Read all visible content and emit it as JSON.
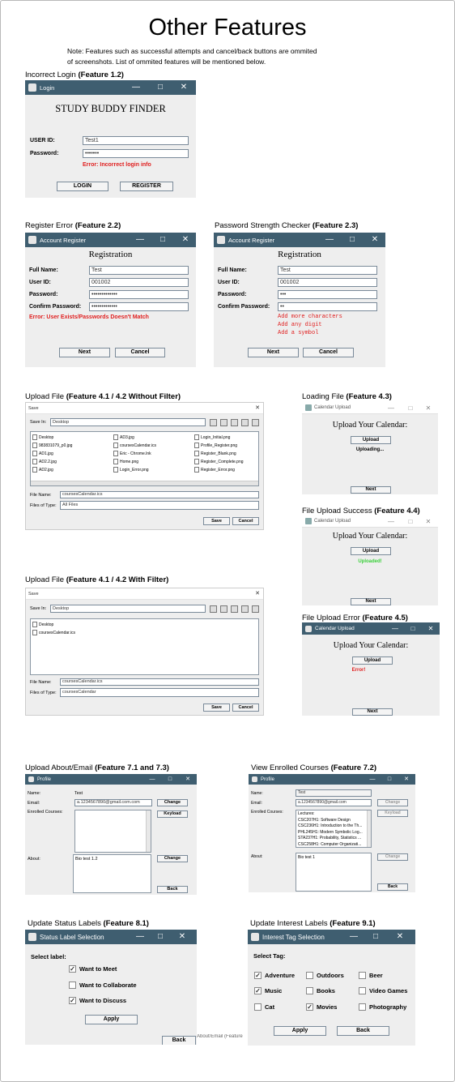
{
  "page": {
    "title": "Other Features",
    "note_line1": "Note: Features such as successful attempts and cancel/back buttons are ommited",
    "note_line2": "of screenshots. List of ommited features will be mentioned below."
  },
  "sections": {
    "s1": {
      "text": "Incorrect Login ",
      "bold": "(Feature 1.2)"
    },
    "s2": {
      "text": "Register Error ",
      "bold": "(Feature 2.2)"
    },
    "s3": {
      "text": "Password Strength Checker ",
      "bold": "(Feature 2.3)"
    },
    "s4": {
      "text": "Upload File ",
      "bold": "(Feature 4.1 / 4.2 Without Filter)"
    },
    "s5": {
      "text": "Loading File ",
      "bold": "(Feature 4.3)"
    },
    "s6": {
      "text": "File Upload Success ",
      "bold": "(Feature 4.4)"
    },
    "s7": {
      "text": "Upload File ",
      "bold": "(Feature 4.1 / 4.2 With Filter)"
    },
    "s8": {
      "text": "File Upload Error ",
      "bold": "(Feature 4.5)"
    },
    "s9": {
      "text": "Upload About/Email ",
      "bold": "(Feature 7.1 and 7.3)"
    },
    "s10": {
      "text": "View  Enrolled Courses ",
      "bold": "(Feature 7.2)"
    },
    "s11": {
      "text": "Update Status Labels ",
      "bold": "(Feature 8.1)"
    },
    "s12": {
      "text": "Update Interest Labels ",
      "bold": "(Feature 9.1)"
    }
  },
  "login": {
    "title": "Login",
    "header": "STUDY BUDDY FINDER",
    "userid_label": "USER ID:",
    "userid_value": "Test1",
    "password_label": "Password:",
    "password_value": "•••••••",
    "error": "Error: Incorrect login info",
    "login_btn": "LOGIN",
    "register_btn": "REGISTER"
  },
  "reg1": {
    "title": "Account Register",
    "header": "Registration",
    "full_name_label": "Full Name:",
    "full_name": "Test",
    "user_id_label": "User ID:",
    "user_id": "001002",
    "password_label": "Password:",
    "password": "•••••••••••••",
    "confirm_label": "Confirm Password:",
    "confirm": "•••••••••••••",
    "error": "Error: User Exists/Passwords Doesn't Match",
    "next_btn": "Next",
    "cancel_btn": "Cancel"
  },
  "reg2": {
    "title": "Account Register",
    "header": "Registration",
    "full_name_label": "Full Name:",
    "full_name": "Test",
    "user_id_label": "User ID:",
    "user_id": "001002",
    "password_label": "Password:",
    "password": "•••",
    "confirm_label": "Confirm Password:",
    "confirm": "••",
    "err1": "Add more characters",
    "err2": "Add any digit",
    "err3": "Add a symbol",
    "next_btn": "Next",
    "cancel_btn": "Cancel"
  },
  "save1": {
    "title": "Save",
    "save_in_label": "Save In:",
    "save_in": "Desktop",
    "files": [
      "Desktop",
      "983831079_p0.jpg",
      "AD1.jpg",
      "AD2.2.jpg",
      "AD2.jpg",
      "AD3.jpg",
      "coursesCalendar.ics",
      "Eric - Chrome.lnk",
      "Home.png",
      "Login_Error.png",
      "Login_Initial.png",
      "Profile_Register.png",
      "Register_Blank.png",
      "Register_Complete.png",
      "Register_Error.png"
    ],
    "file_name_label": "File Name:",
    "file_name": "coursesCalendar.ics",
    "file_type_label": "Files of Type:",
    "file_type": "All Files",
    "save_btn": "Save",
    "cancel_btn": "Cancel"
  },
  "save2": {
    "title": "Save",
    "save_in_label": "Save In:",
    "save_in": "Desktop",
    "files": [
      "Desktop",
      "coursesCalendar.ics"
    ],
    "file_name_label": "File Name:",
    "file_name": "coursesCalendar.ics",
    "file_type_label": "Files of Type:",
    "file_type": "coursesCalendar",
    "save_btn": "Save",
    "cancel_btn": "Cancel"
  },
  "cal1": {
    "title": "Calendar Upload",
    "header": "Upload Your Calendar:",
    "upload_btn": "Upload",
    "status": "Uploading...",
    "next_btn": "Next"
  },
  "cal2": {
    "title": "Calendar Upload",
    "header": "Upload Your Calendar:",
    "upload_btn": "Upload",
    "status": "Uploaded!",
    "next_btn": "Next"
  },
  "cal3": {
    "title": "Calendar Upload",
    "header": "Upload Your Calendar:",
    "upload_btn": "Upload",
    "status": "Error!",
    "next_btn": "Next"
  },
  "profile1": {
    "title": "Profile",
    "name_label": "Name:",
    "name": "Test",
    "email_label": "Email:",
    "email": "a.1234567890@gmail.com.com",
    "courses_label": "Enrolled Courses:",
    "about_label": "About:",
    "about": "Bio test 1.2",
    "change_btn": "Change",
    "keyload_btn": "Keyload",
    "change2_btn": "Change",
    "back_btn": "Back"
  },
  "profile2": {
    "title": "Profile",
    "name_label": "Name:",
    "name": "Test",
    "email_label": "Email:",
    "email": "a.1234567890@gmail.com",
    "courses_label": "Enrolled Courses:",
    "courses": [
      "Lectures:",
      "CSC207H1: Software Design",
      "CSC236H1: Introduction to the Th...",
      "PHL245H1: Modern Symbolic Log...",
      "STA237H1: Probability, Statistics ...",
      "CSC258H1: Computer Organizati..."
    ],
    "about_label": "About:",
    "about": "Bio test 1",
    "change_btn": "Change",
    "keyload_btn": "Keyload",
    "change2_btn": "Change",
    "back_btn": "Back"
  },
  "status": {
    "title": "Status Label Selection",
    "select_label": "Select label:",
    "options": [
      {
        "label": "Want to Meet",
        "checked": "✓"
      },
      {
        "label": "Want to Collaborate",
        "checked": ""
      },
      {
        "label": "Want to Discuss",
        "checked": "✓"
      }
    ],
    "apply_btn": "Apply",
    "back_btn": "Back",
    "caption": "About/Email (Feature"
  },
  "interest": {
    "title": "Interest Tag Selection",
    "select_label": "Select Tag:",
    "tags": [
      {
        "label": "Adventure",
        "checked": "✓"
      },
      {
        "label": "Outdoors",
        "checked": ""
      },
      {
        "label": "Beer",
        "checked": ""
      },
      {
        "label": "Music",
        "checked": "✓"
      },
      {
        "label": "Books",
        "checked": ""
      },
      {
        "label": "Video Games",
        "checked": ""
      },
      {
        "label": "Cat",
        "checked": ""
      },
      {
        "label": "Movies",
        "checked": "✓"
      },
      {
        "label": "Photography",
        "checked": ""
      }
    ],
    "apply_btn": "Apply",
    "back_btn": "Back"
  },
  "window_controls": {
    "minimize": "—",
    "maximize": "□",
    "close": "✕"
  }
}
